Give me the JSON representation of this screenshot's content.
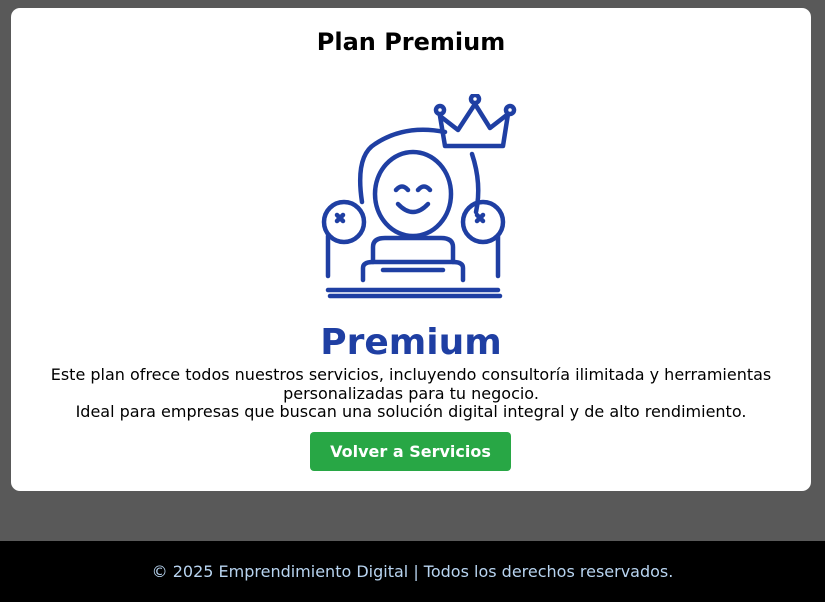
{
  "page": {
    "title": "Plan Premium",
    "illustration": {
      "icon": "crown-armchair-smiley-icon",
      "caption": "Premium",
      "color": "#1f3fa3"
    },
    "description_line1": "Este plan ofrece todos nuestros servicios, incluyendo consultoría ilimitada y herramientas personalizadas para tu negocio.",
    "description_line2": "Ideal para empresas que buscan una solución digital integral y de alto rendimiento.",
    "back_button_label": "Volver a Servicios",
    "button_color": "#28a745"
  },
  "footer": {
    "text": "© 2025 Emprendimiento Digital | Todos los derechos reservados."
  }
}
